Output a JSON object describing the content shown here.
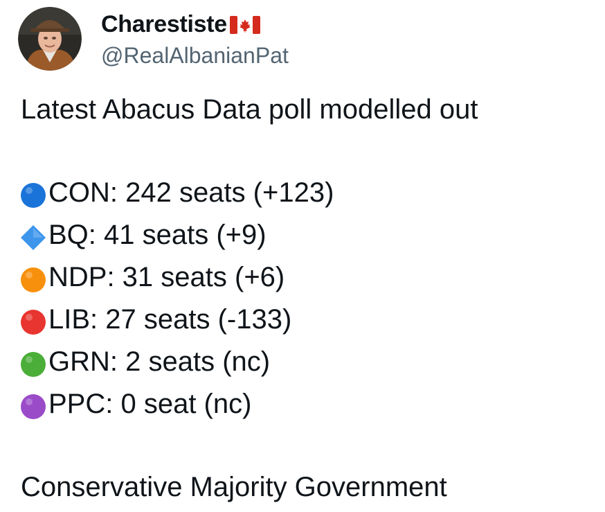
{
  "author": {
    "display_name": "Charestiste",
    "handle": "@RealAlbanianPat"
  },
  "tweet": {
    "headline": "Latest Abacus Data poll modelled out",
    "parties": [
      {
        "text": "CON: 242 seats (+123)",
        "icon": "blue-circle-icon",
        "color": "#1a73d9"
      },
      {
        "text": "BQ: 41 seats (+9)",
        "icon": "blue-diamond-icon",
        "color": "#3d95ec"
      },
      {
        "text": "NDP: 31 seats (+6)",
        "icon": "orange-circle-icon",
        "color": "#f7900c"
      },
      {
        "text": "LIB: 27 seats (-133)",
        "icon": "red-circle-icon",
        "color": "#e8352f"
      },
      {
        "text": "GRN: 2 seats (nc)",
        "icon": "green-circle-icon",
        "color": "#4aae38"
      },
      {
        "text": "PPC: 0 seat (nc)",
        "icon": "purple-circle-icon",
        "color": "#9a4bc8"
      }
    ],
    "conclusion": "Conservative Majority Government"
  },
  "colors": {
    "text_primary": "#0f1419",
    "text_secondary": "#536471",
    "flag_red": "#d52b1e"
  }
}
